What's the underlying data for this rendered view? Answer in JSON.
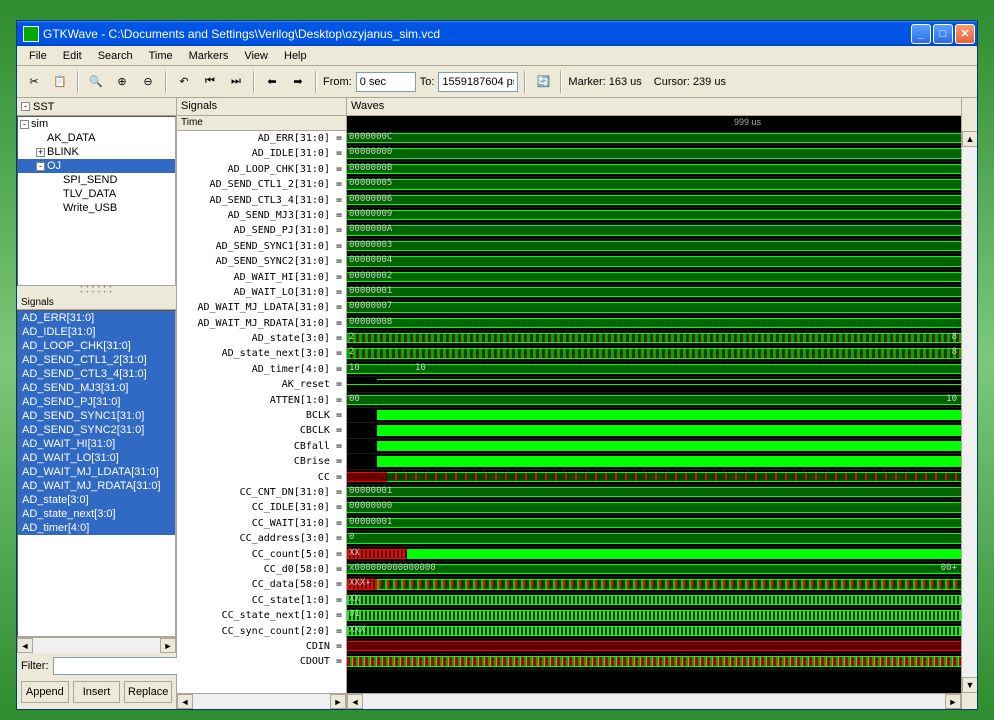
{
  "title": "GTKWave - C:\\Documents and Settings\\Verilog\\Desktop\\ozyjanus_sim.vcd",
  "menu": [
    "File",
    "Edit",
    "Search",
    "Time",
    "Markers",
    "View",
    "Help"
  ],
  "toolbar": {
    "from_label": "From:",
    "from_value": "0 sec",
    "to_label": "To:",
    "to_value": "1559187604 ps",
    "marker": "Marker: 163 us",
    "cursor": "Cursor: 239 us"
  },
  "sst_header": "SST",
  "tree": [
    {
      "label": "sim",
      "indent": 0,
      "expand": "-"
    },
    {
      "label": "AK_DATA",
      "indent": 1,
      "expand": ""
    },
    {
      "label": "BLINK",
      "indent": 1,
      "expand": "+"
    },
    {
      "label": "OJ",
      "indent": 1,
      "expand": "-",
      "selected": true
    },
    {
      "label": "SPI_SEND",
      "indent": 2,
      "expand": ""
    },
    {
      "label": "TLV_DATA",
      "indent": 2,
      "expand": ""
    },
    {
      "label": "Write_USB",
      "indent": 2,
      "expand": ""
    }
  ],
  "signals_header": "Signals",
  "signals": [
    "AD_ERR[31:0]",
    "AD_IDLE[31:0]",
    "AD_LOOP_CHK[31:0]",
    "AD_SEND_CTL1_2[31:0]",
    "AD_SEND_CTL3_4[31:0]",
    "AD_SEND_MJ3[31:0]",
    "AD_SEND_PJ[31:0]",
    "AD_SEND_SYNC1[31:0]",
    "AD_SEND_SYNC2[31:0]",
    "AD_WAIT_HI[31:0]",
    "AD_WAIT_LO[31:0]",
    "AD_WAIT_MJ_LDATA[31:0]",
    "AD_WAIT_MJ_RDATA[31:0]",
    "AD_state[3:0]",
    "AD_state_next[3:0]",
    "AD_timer[4:0]"
  ],
  "filter_label": "Filter:",
  "btns": {
    "append": "Append",
    "insert": "Insert",
    "replace": "Replace"
  },
  "mid_signals_header": "Signals",
  "time_header": "Time",
  "wave_header": "Waves",
  "time_scale": "999 us",
  "rows": [
    {
      "name": "AD_ERR[31:0] =",
      "val": "0000000C",
      "type": "bus"
    },
    {
      "name": "AD_IDLE[31:0] =",
      "val": "00000000",
      "type": "bus"
    },
    {
      "name": "AD_LOOP_CHK[31:0] =",
      "val": "0000000B",
      "type": "bus"
    },
    {
      "name": "AD_SEND_CTL1_2[31:0] =",
      "val": "00000005",
      "type": "bus"
    },
    {
      "name": "AD_SEND_CTL3_4[31:0] =",
      "val": "00000006",
      "type": "bus"
    },
    {
      "name": "AD_SEND_MJ3[31:0] =",
      "val": "00000009",
      "type": "bus"
    },
    {
      "name": "AD_SEND_PJ[31:0] =",
      "val": "0000000A",
      "type": "bus"
    },
    {
      "name": "AD_SEND_SYNC1[31:0] =",
      "val": "00000003",
      "type": "bus"
    },
    {
      "name": "AD_SEND_SYNC2[31:0] =",
      "val": "00000004",
      "type": "bus"
    },
    {
      "name": "AD_WAIT_HI[31:0] =",
      "val": "00000002",
      "type": "bus"
    },
    {
      "name": "AD_WAIT_LO[31:0] =",
      "val": "00000001",
      "type": "bus"
    },
    {
      "name": "AD_WAIT_MJ_LDATA[31:0] =",
      "val": "00000007",
      "type": "bus"
    },
    {
      "name": "AD_WAIT_MJ_RDATA[31:0] =",
      "val": "00000008",
      "type": "bus"
    },
    {
      "name": "AD_state[3:0] =",
      "val": "2",
      "type": "mix",
      "rval": "8"
    },
    {
      "name": "AD_state_next[3:0] =",
      "val": "2",
      "type": "mix",
      "rval": "8"
    },
    {
      "name": "AD_timer[4:0] =",
      "val": "10",
      "type": "bus2",
      "val2": "10"
    },
    {
      "name": "AK_reset =",
      "val": "",
      "type": "step"
    },
    {
      "name": "ATTEN[1:0] =",
      "val": "00",
      "type": "bus",
      "rval": "10"
    },
    {
      "name": "BCLK =",
      "val": "",
      "type": "bright"
    },
    {
      "name": "CBCLK =",
      "val": "",
      "type": "bright"
    },
    {
      "name": "CBfall =",
      "val": "",
      "type": "bright"
    },
    {
      "name": "CBrise =",
      "val": "",
      "type": "bright"
    },
    {
      "name": "CC =",
      "val": "",
      "type": "redmix"
    },
    {
      "name": "CC_CNT_DN[31:0] =",
      "val": "00000001",
      "type": "bus"
    },
    {
      "name": "CC_IDLE[31:0] =",
      "val": "00000000",
      "type": "bus"
    },
    {
      "name": "CC_WAIT[31:0] =",
      "val": "00000001",
      "type": "bus"
    },
    {
      "name": "CC_address[3:0] =",
      "val": "0",
      "type": "bus"
    },
    {
      "name": "CC_count[5:0] =",
      "val": "XX",
      "type": "brightmix"
    },
    {
      "name": "CC_d0[58:0] =",
      "val": "x000000000000000",
      "type": "bus",
      "rval": "00+"
    },
    {
      "name": "CC_data[58:0] =",
      "val": "XXX+",
      "type": "redmix2"
    },
    {
      "name": "CC_state[1:0] =",
      "val": "XX",
      "type": "mixdense"
    },
    {
      "name": "CC_state_next[1:0] =",
      "val": "01",
      "type": "mixdense"
    },
    {
      "name": "CC_sync_count[2:0] =",
      "val": "XXX",
      "type": "mixdense"
    },
    {
      "name": "CDIN =",
      "val": "",
      "type": "red"
    },
    {
      "name": "CDOUT =",
      "val": "",
      "type": "redmix3"
    }
  ]
}
